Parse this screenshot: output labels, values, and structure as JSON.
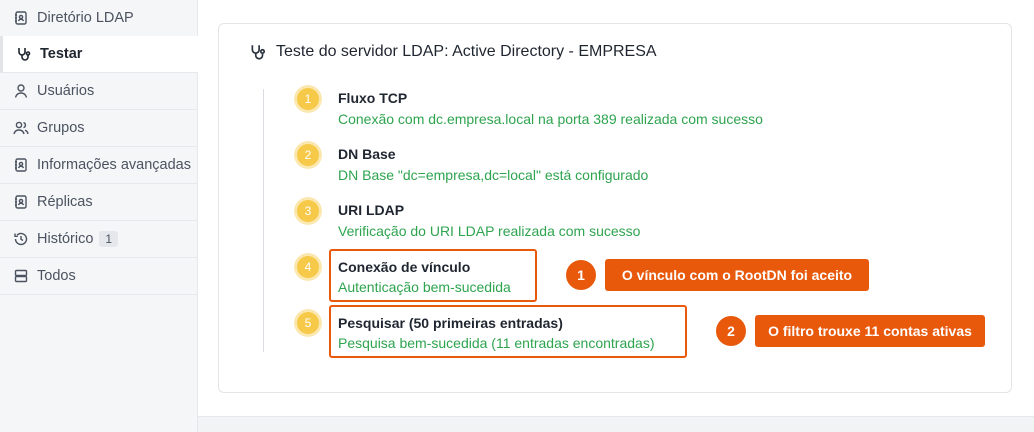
{
  "sidebar": {
    "items": [
      {
        "label": "Diretório LDAP",
        "icon": "address-book-icon"
      },
      {
        "label": "Testar",
        "icon": "stethoscope-icon"
      },
      {
        "label": "Usuários",
        "icon": "user-icon"
      },
      {
        "label": "Grupos",
        "icon": "users-icon"
      },
      {
        "label": "Informações avançadas",
        "icon": "address-book-icon"
      },
      {
        "label": "Réplicas",
        "icon": "address-book-icon"
      },
      {
        "label": "Histórico",
        "icon": "history-icon",
        "badge": "1"
      },
      {
        "label": "Todos",
        "icon": "database-icon"
      }
    ]
  },
  "card": {
    "title": "Teste do servidor LDAP: Active Directory - EMPRESA"
  },
  "steps": [
    {
      "number": "1",
      "title": "Fluxo TCP",
      "description": "Conexão com dc.empresa.local na porta 389 realizada com sucesso"
    },
    {
      "number": "2",
      "title": "DN Base",
      "description": "DN Base \"dc=empresa,dc=local\" está configurado"
    },
    {
      "number": "3",
      "title": "URI LDAP",
      "description": "Verificação do URI LDAP realizada com sucesso"
    },
    {
      "number": "4",
      "title": "Conexão de vínculo",
      "description": "Autenticação bem-sucedida"
    },
    {
      "number": "5",
      "title": "Pesquisar (50 primeiras entradas)",
      "description": "Pesquisa bem-sucedida (11 entradas encontradas)"
    }
  ],
  "callouts": [
    {
      "number": "1",
      "text": "O vínculo com o RootDN foi aceito"
    },
    {
      "number": "2",
      "text": "O filtro trouxe 11 contas ativas"
    }
  ],
  "colors": {
    "accent": "#e8590c",
    "success": "#2ea44f",
    "step_badge": "#f7c948"
  }
}
